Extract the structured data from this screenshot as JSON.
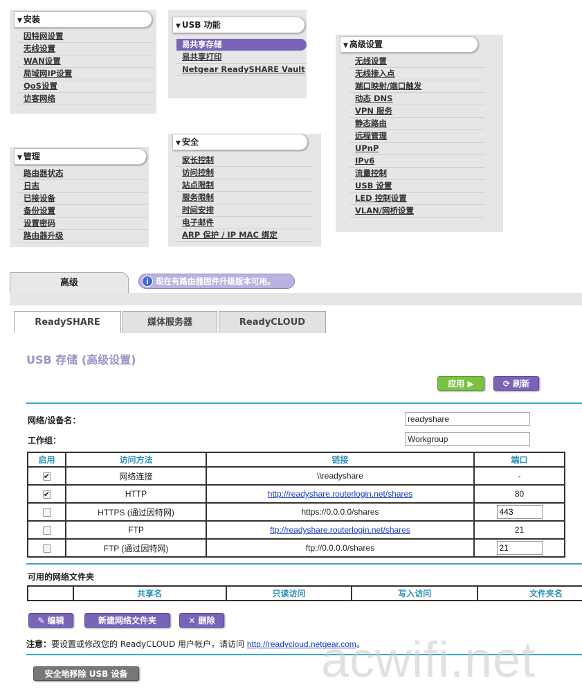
{
  "menus": {
    "setup": {
      "title": "安装",
      "items": [
        "因特网设置",
        "无线设置",
        "WAN设置",
        "局域网IP设置",
        "QoS设置",
        "访客网络"
      ]
    },
    "usb": {
      "title": "USB 功能",
      "items": [
        "易共享存储",
        "易共享打印",
        "Netgear ReadySHARE Vault"
      ]
    },
    "advanced_setup": {
      "title": "高级设置",
      "items": [
        "无线设置",
        "无线接入点",
        "端口映射/端口触发",
        "动态 DNS",
        "VPN 服务",
        "静态路由",
        "远程管理",
        "UPnP",
        "IPv6",
        "流量控制",
        "USB 设置",
        "LED 控制设置",
        "VLAN/网桥设置"
      ]
    },
    "manage": {
      "title": "管理",
      "items": [
        "路由器状态",
        "日志",
        "已接设备",
        "备份设置",
        "设置密码",
        "路由器升级"
      ]
    },
    "security": {
      "title": "安全",
      "items": [
        "家长控制",
        "访问控制",
        "站点限制",
        "服务限制",
        "时间安排",
        "电子邮件",
        "ARP 保护 / IP MAC 绑定"
      ]
    }
  },
  "main_tab": "高级",
  "firmware_notice": "现在有路由器固件升级版本可用。",
  "sub_tabs": [
    "ReadySHARE",
    "媒体服务器",
    "ReadyCLOUD"
  ],
  "page_title": "USB 存储 (高级设置)",
  "buttons": {
    "apply": "应用 ▶",
    "refresh": "刷新",
    "edit": "编辑",
    "new_folder": "新建网络文件夹",
    "delete": "删除",
    "safe_remove": "安全地移除 USB 设备"
  },
  "form": {
    "device_name_label": "网络/设备名：",
    "device_name_value": "readyshare",
    "workgroup_label": "工作组：",
    "workgroup_value": "Workgroup"
  },
  "access_table": {
    "headers": [
      "启用",
      "访问方法",
      "链接",
      "端口"
    ],
    "rows": [
      {
        "enabled": true,
        "method": "网络连接",
        "link": "\\\\readyshare",
        "port": "-",
        "link_is_url": false,
        "port_editable": false
      },
      {
        "enabled": true,
        "method": "HTTP",
        "link": "http://readyshare.routerlogin.net/shares",
        "port": "80",
        "link_is_url": true,
        "port_editable": false
      },
      {
        "enabled": false,
        "method": "HTTPS (通过因特网)",
        "link": "https://0.0.0.0/shares",
        "port": "443",
        "link_is_url": false,
        "port_editable": true
      },
      {
        "enabled": false,
        "method": "FTP",
        "link": "ftp://readyshare.routerlogin.net/shares",
        "port": "21",
        "link_is_url": true,
        "port_editable": false
      },
      {
        "enabled": false,
        "method": "FTP (通过因特网)",
        "link": "ftp://0.0.0.0/shares",
        "port": "21",
        "link_is_url": false,
        "port_editable": true
      }
    ]
  },
  "folders_section": {
    "title": "可用的网络文件夹",
    "headers": [
      "",
      "共享名",
      "只读访问",
      "写入访问",
      "文件夹名"
    ]
  },
  "note": {
    "label": "注意：",
    "text": "要设置或修改您的 ReadyCLOUD 用户帐户，请访问 ",
    "link": "http://readycloud.netgear.com",
    "suffix": "。"
  },
  "watermark": "acwifi.net"
}
